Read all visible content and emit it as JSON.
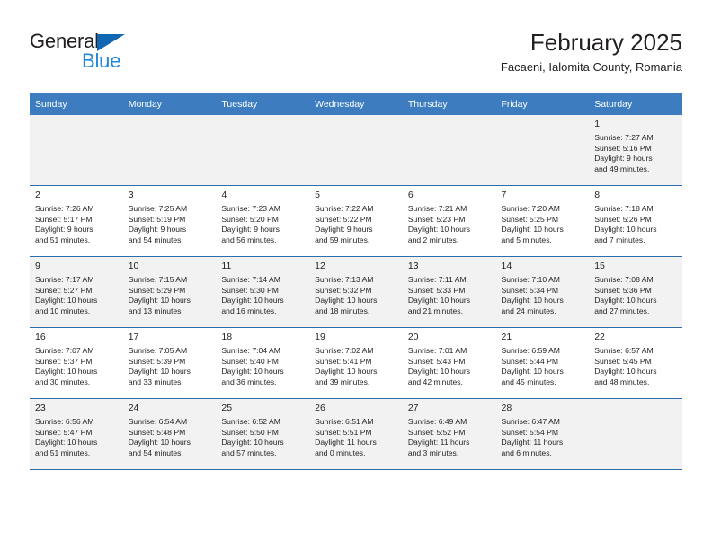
{
  "logo": {
    "word_one": "General",
    "word_two": "Blue",
    "triangle_icon": "triangle-icon",
    "accent_dark": "#231f20",
    "accent_blue": "#2288dd",
    "triangle_color": "#1267b2"
  },
  "header": {
    "title": "February 2025",
    "subtitle": "Facaeni, Ialomita County, Romania"
  },
  "calendar": {
    "header_bg": "#3c7cbf",
    "header_text_color": "#ffffff",
    "shaded_cell_bg": "#f2f2f2",
    "weekdays": [
      "Sunday",
      "Monday",
      "Tuesday",
      "Wednesday",
      "Thursday",
      "Friday",
      "Saturday"
    ],
    "weeks": [
      [
        {
          "empty": true
        },
        {
          "empty": true
        },
        {
          "empty": true
        },
        {
          "empty": true
        },
        {
          "empty": true
        },
        {
          "empty": true
        },
        {
          "day": "1",
          "sunrise": "Sunrise: 7:27 AM",
          "sunset": "Sunset: 5:16 PM",
          "daylight_line1": "Daylight: 9 hours",
          "daylight_line2": "and 49 minutes."
        }
      ],
      [
        {
          "day": "2",
          "sunrise": "Sunrise: 7:26 AM",
          "sunset": "Sunset: 5:17 PM",
          "daylight_line1": "Daylight: 9 hours",
          "daylight_line2": "and 51 minutes."
        },
        {
          "day": "3",
          "sunrise": "Sunrise: 7:25 AM",
          "sunset": "Sunset: 5:19 PM",
          "daylight_line1": "Daylight: 9 hours",
          "daylight_line2": "and 54 minutes."
        },
        {
          "day": "4",
          "sunrise": "Sunrise: 7:23 AM",
          "sunset": "Sunset: 5:20 PM",
          "daylight_line1": "Daylight: 9 hours",
          "daylight_line2": "and 56 minutes."
        },
        {
          "day": "5",
          "sunrise": "Sunrise: 7:22 AM",
          "sunset": "Sunset: 5:22 PM",
          "daylight_line1": "Daylight: 9 hours",
          "daylight_line2": "and 59 minutes."
        },
        {
          "day": "6",
          "sunrise": "Sunrise: 7:21 AM",
          "sunset": "Sunset: 5:23 PM",
          "daylight_line1": "Daylight: 10 hours",
          "daylight_line2": "and 2 minutes."
        },
        {
          "day": "7",
          "sunrise": "Sunrise: 7:20 AM",
          "sunset": "Sunset: 5:25 PM",
          "daylight_line1": "Daylight: 10 hours",
          "daylight_line2": "and 5 minutes."
        },
        {
          "day": "8",
          "sunrise": "Sunrise: 7:18 AM",
          "sunset": "Sunset: 5:26 PM",
          "daylight_line1": "Daylight: 10 hours",
          "daylight_line2": "and 7 minutes."
        }
      ],
      [
        {
          "day": "9",
          "sunrise": "Sunrise: 7:17 AM",
          "sunset": "Sunset: 5:27 PM",
          "daylight_line1": "Daylight: 10 hours",
          "daylight_line2": "and 10 minutes."
        },
        {
          "day": "10",
          "sunrise": "Sunrise: 7:15 AM",
          "sunset": "Sunset: 5:29 PM",
          "daylight_line1": "Daylight: 10 hours",
          "daylight_line2": "and 13 minutes."
        },
        {
          "day": "11",
          "sunrise": "Sunrise: 7:14 AM",
          "sunset": "Sunset: 5:30 PM",
          "daylight_line1": "Daylight: 10 hours",
          "daylight_line2": "and 16 minutes."
        },
        {
          "day": "12",
          "sunrise": "Sunrise: 7:13 AM",
          "sunset": "Sunset: 5:32 PM",
          "daylight_line1": "Daylight: 10 hours",
          "daylight_line2": "and 18 minutes."
        },
        {
          "day": "13",
          "sunrise": "Sunrise: 7:11 AM",
          "sunset": "Sunset: 5:33 PM",
          "daylight_line1": "Daylight: 10 hours",
          "daylight_line2": "and 21 minutes."
        },
        {
          "day": "14",
          "sunrise": "Sunrise: 7:10 AM",
          "sunset": "Sunset: 5:34 PM",
          "daylight_line1": "Daylight: 10 hours",
          "daylight_line2": "and 24 minutes."
        },
        {
          "day": "15",
          "sunrise": "Sunrise: 7:08 AM",
          "sunset": "Sunset: 5:36 PM",
          "daylight_line1": "Daylight: 10 hours",
          "daylight_line2": "and 27 minutes."
        }
      ],
      [
        {
          "day": "16",
          "sunrise": "Sunrise: 7:07 AM",
          "sunset": "Sunset: 5:37 PM",
          "daylight_line1": "Daylight: 10 hours",
          "daylight_line2": "and 30 minutes."
        },
        {
          "day": "17",
          "sunrise": "Sunrise: 7:05 AM",
          "sunset": "Sunset: 5:39 PM",
          "daylight_line1": "Daylight: 10 hours",
          "daylight_line2": "and 33 minutes."
        },
        {
          "day": "18",
          "sunrise": "Sunrise: 7:04 AM",
          "sunset": "Sunset: 5:40 PM",
          "daylight_line1": "Daylight: 10 hours",
          "daylight_line2": "and 36 minutes."
        },
        {
          "day": "19",
          "sunrise": "Sunrise: 7:02 AM",
          "sunset": "Sunset: 5:41 PM",
          "daylight_line1": "Daylight: 10 hours",
          "daylight_line2": "and 39 minutes."
        },
        {
          "day": "20",
          "sunrise": "Sunrise: 7:01 AM",
          "sunset": "Sunset: 5:43 PM",
          "daylight_line1": "Daylight: 10 hours",
          "daylight_line2": "and 42 minutes."
        },
        {
          "day": "21",
          "sunrise": "Sunrise: 6:59 AM",
          "sunset": "Sunset: 5:44 PM",
          "daylight_line1": "Daylight: 10 hours",
          "daylight_line2": "and 45 minutes."
        },
        {
          "day": "22",
          "sunrise": "Sunrise: 6:57 AM",
          "sunset": "Sunset: 5:45 PM",
          "daylight_line1": "Daylight: 10 hours",
          "daylight_line2": "and 48 minutes."
        }
      ],
      [
        {
          "day": "23",
          "sunrise": "Sunrise: 6:56 AM",
          "sunset": "Sunset: 5:47 PM",
          "daylight_line1": "Daylight: 10 hours",
          "daylight_line2": "and 51 minutes."
        },
        {
          "day": "24",
          "sunrise": "Sunrise: 6:54 AM",
          "sunset": "Sunset: 5:48 PM",
          "daylight_line1": "Daylight: 10 hours",
          "daylight_line2": "and 54 minutes."
        },
        {
          "day": "25",
          "sunrise": "Sunrise: 6:52 AM",
          "sunset": "Sunset: 5:50 PM",
          "daylight_line1": "Daylight: 10 hours",
          "daylight_line2": "and 57 minutes."
        },
        {
          "day": "26",
          "sunrise": "Sunrise: 6:51 AM",
          "sunset": "Sunset: 5:51 PM",
          "daylight_line1": "Daylight: 11 hours",
          "daylight_line2": "and 0 minutes."
        },
        {
          "day": "27",
          "sunrise": "Sunrise: 6:49 AM",
          "sunset": "Sunset: 5:52 PM",
          "daylight_line1": "Daylight: 11 hours",
          "daylight_line2": "and 3 minutes."
        },
        {
          "day": "28",
          "sunrise": "Sunrise: 6:47 AM",
          "sunset": "Sunset: 5:54 PM",
          "daylight_line1": "Daylight: 11 hours",
          "daylight_line2": "and 6 minutes."
        },
        {
          "empty": true
        }
      ]
    ]
  }
}
